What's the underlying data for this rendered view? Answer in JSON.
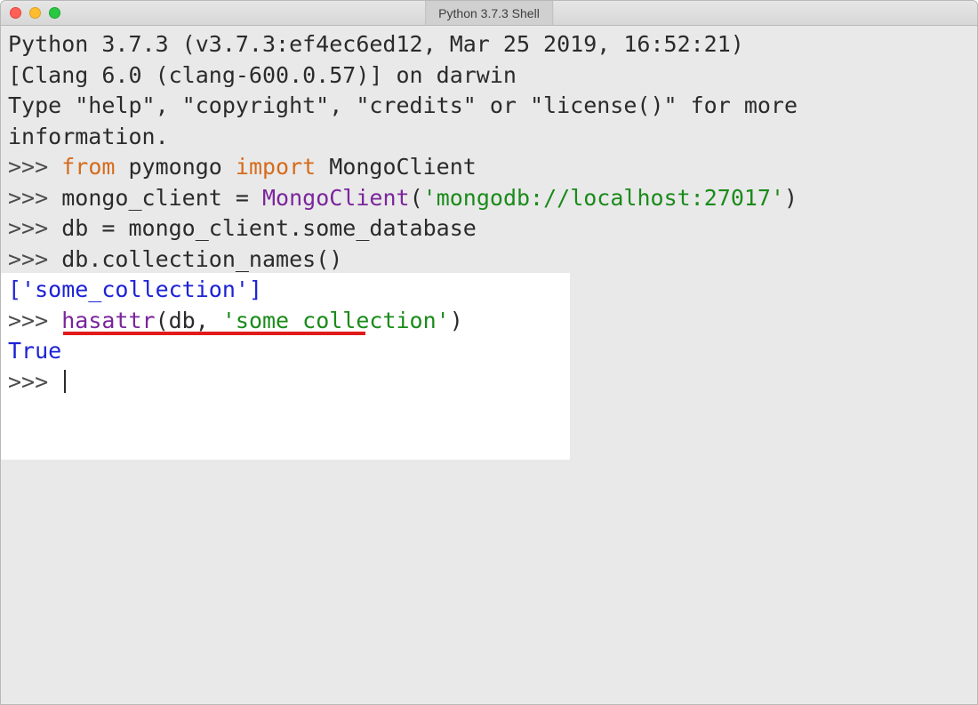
{
  "window": {
    "title": "Python 3.7.3 Shell"
  },
  "banner": {
    "line1": "Python 3.7.3 (v3.7.3:ef4ec6ed12, Mar 25 2019, 16:52:21)",
    "line2": "[Clang 6.0 (clang-600.0.57)] on darwin",
    "line3": "Type \"help\", \"copyright\", \"credits\" or \"license()\" for more information."
  },
  "prompt": ">>> ",
  "code": {
    "l1": {
      "kw1": "from",
      "txt1": " pymongo ",
      "kw2": "import",
      "txt2": " MongoClient"
    },
    "l2": {
      "txt1": "mongo_client = ",
      "call": "MongoClient",
      "txt2": "(",
      "str": "'mongodb://localhost:27017'",
      "txt3": ")"
    },
    "l3": {
      "txt": "db = mongo_client.some_database"
    },
    "l4": {
      "txt": "db.collection_names()"
    },
    "out1": "['some_collection']",
    "l5": {
      "call": "hasattr",
      "txt1": "(db, ",
      "str": "'some_collection'",
      "txt2": ")"
    },
    "out2": "True"
  }
}
